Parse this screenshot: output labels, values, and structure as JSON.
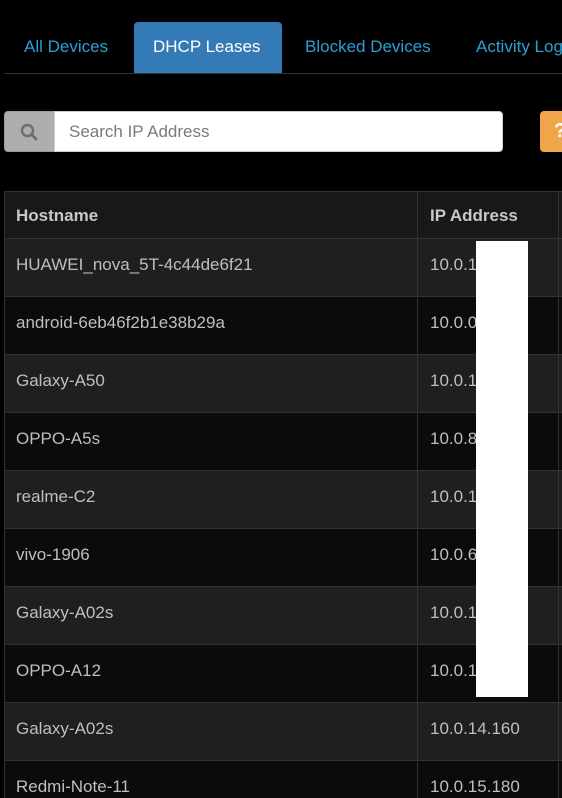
{
  "tabs": [
    {
      "label": "All Devices",
      "active": false
    },
    {
      "label": "DHCP Leases",
      "active": true
    },
    {
      "label": "Blocked Devices",
      "active": false
    },
    {
      "label": "Activity Log",
      "active": false
    }
  ],
  "search": {
    "placeholder": "Search IP Address",
    "value": "",
    "icon": "search-icon"
  },
  "help_button": {
    "label": "?",
    "color": "#f0a54a"
  },
  "table": {
    "columns": [
      "Hostname",
      "IP Address"
    ],
    "rows": [
      [
        "HUAWEI_nova_5T-4c44de6f21",
        "10.0.1"
      ],
      [
        "android-6eb46f2b1e38b29a",
        "10.0.0"
      ],
      [
        "Galaxy-A50",
        "10.0.1"
      ],
      [
        "OPPO-A5s",
        "10.0.8"
      ],
      [
        "realme-C2",
        "10.0.1"
      ],
      [
        "vivo-1906",
        "10.0.6"
      ],
      [
        "Galaxy-A02s",
        "10.0.1"
      ],
      [
        "OPPO-A12",
        "10.0.1"
      ],
      [
        "Galaxy-A02s",
        "10.0.14.160"
      ],
      [
        "Redmi-Note-11",
        "10.0.15.180"
      ]
    ]
  },
  "colors": {
    "accent": "#2a9fd6",
    "active_tab": "#337ab7",
    "background": "#000000",
    "row_odd": "#1f1f1f",
    "row_even": "#0b0b0b",
    "text": "#bfbfbf"
  }
}
